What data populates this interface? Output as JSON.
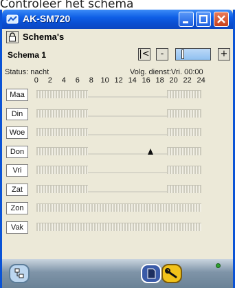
{
  "caption": "Controleer het schema",
  "window": {
    "title": "AK-SM720"
  },
  "toolbar": {
    "schemas_label": "Schema's"
  },
  "schema": {
    "name": "Schema 1",
    "nav": {
      "first": "|<",
      "minus": "-",
      "plus": "+"
    }
  },
  "status": {
    "text": "Status: nacht",
    "next_service": "Volg. dienst:Vri. 00:00"
  },
  "hours": [
    "0",
    "2",
    "4",
    "6",
    "8",
    "10",
    "12",
    "14",
    "16",
    "18",
    "20",
    "22",
    "24"
  ],
  "days": [
    {
      "label": "Maa",
      "segments": [
        {
          "from": 0,
          "to": 7.5,
          "state": "high"
        },
        {
          "from": 7.5,
          "to": 19,
          "state": "low"
        },
        {
          "from": 19,
          "to": 24,
          "state": "high"
        }
      ]
    },
    {
      "label": "Din",
      "segments": [
        {
          "from": 0,
          "to": 7.5,
          "state": "high"
        },
        {
          "from": 7.5,
          "to": 19,
          "state": "low"
        },
        {
          "from": 19,
          "to": 24,
          "state": "high"
        }
      ]
    },
    {
      "label": "Woe",
      "segments": [
        {
          "from": 0,
          "to": 7.5,
          "state": "high"
        },
        {
          "from": 7.5,
          "to": 19,
          "state": "low"
        },
        {
          "from": 19,
          "to": 24,
          "state": "high"
        }
      ]
    },
    {
      "label": "Don",
      "segments": [
        {
          "from": 0,
          "to": 7.5,
          "state": "high"
        },
        {
          "from": 7.5,
          "to": 19,
          "state": "low"
        },
        {
          "from": 19,
          "to": 24,
          "state": "high"
        }
      ],
      "marker": true
    },
    {
      "label": "Vri",
      "segments": [
        {
          "from": 0,
          "to": 7.5,
          "state": "high"
        },
        {
          "from": 7.5,
          "to": 19,
          "state": "low"
        },
        {
          "from": 19,
          "to": 24,
          "state": "high"
        }
      ]
    },
    {
      "label": "Zat",
      "segments": [
        {
          "from": 0,
          "to": 7.5,
          "state": "high"
        },
        {
          "from": 7.5,
          "to": 19,
          "state": "low"
        },
        {
          "from": 19,
          "to": 24,
          "state": "high"
        }
      ]
    },
    {
      "label": "Zon",
      "segments": [
        {
          "from": 0,
          "to": 24,
          "state": "high"
        }
      ]
    },
    {
      "label": "Vak",
      "segments": [
        {
          "from": 0,
          "to": 24,
          "state": "high"
        }
      ]
    }
  ],
  "icons": {
    "title": "network-icon",
    "lock": "lock-icon",
    "bottom_left": "tree-icon",
    "document": "document-icon",
    "service": "wrench-icon",
    "status_led": "led-icon"
  },
  "colors": {
    "titlebar": "#0a4fd2",
    "led": "#2fa12f",
    "wrench": "#f2c31a"
  }
}
